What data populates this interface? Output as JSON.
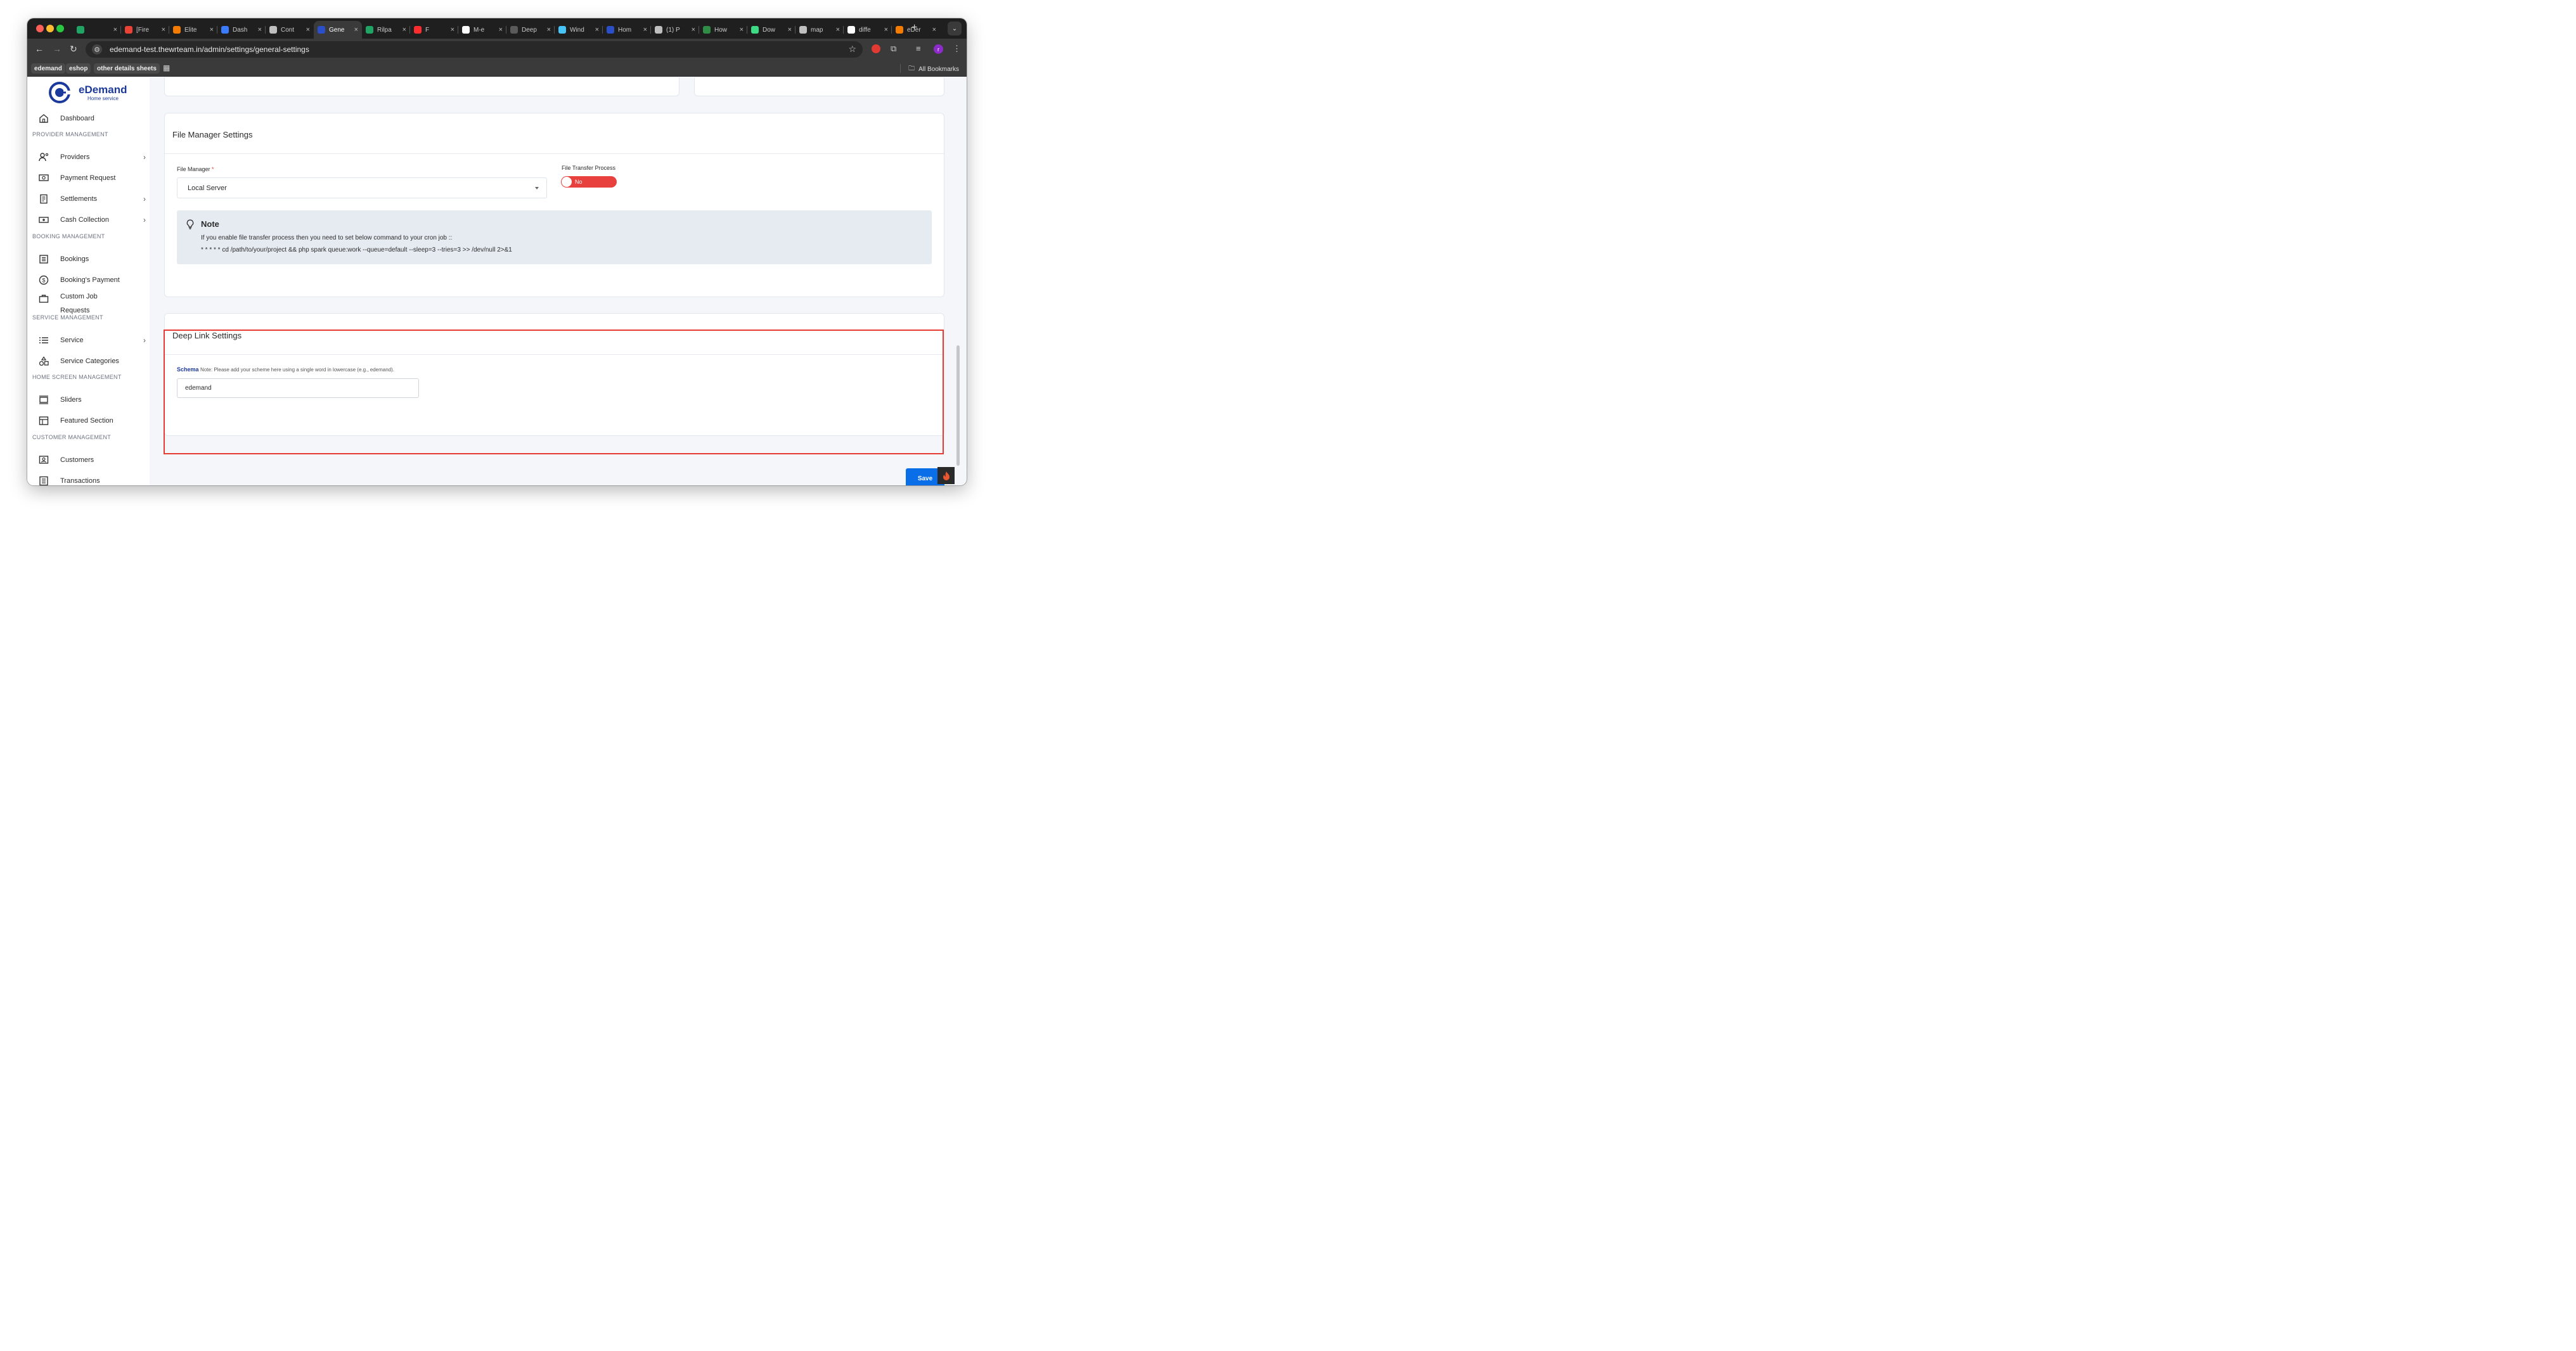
{
  "browser": {
    "tabs": [
      {
        "title": "",
        "favicon": "sheets-icon",
        "color": "#1fa463"
      },
      {
        "title": "[Fire",
        "favicon": "gmail-icon",
        "color": "#ea4335"
      },
      {
        "title": "Elite",
        "favicon": "fire-icon",
        "color": "#f57c00"
      },
      {
        "title": "Dash",
        "favicon": "play-icon",
        "color": "#3b7bff"
      },
      {
        "title": "Cont",
        "favicon": "openai-icon",
        "color": "#bfbfbf"
      },
      {
        "title": "Gene",
        "favicon": "edemand-icon",
        "color": "#2a4fc9"
      },
      {
        "title": "Rilpa",
        "favicon": "sheets-icon",
        "color": "#1fa463"
      },
      {
        "title": "F",
        "favicon": "youtube-music-icon",
        "color": "#ff2d2d"
      },
      {
        "title": "M-e",
        "favicon": "github-icon",
        "color": "#ffffff"
      },
      {
        "title": "Deep",
        "favicon": "link-icon",
        "color": "#5a5a5a"
      },
      {
        "title": "Wind",
        "favicon": "flutter-icon",
        "color": "#47c5fb"
      },
      {
        "title": "Hom",
        "favicon": "edemand-icon",
        "color": "#2a4fc9"
      },
      {
        "title": "(1) P",
        "favicon": "globe-icon",
        "color": "#bfbfbf"
      },
      {
        "title": "How",
        "favicon": "gfg-icon",
        "color": "#2f8d46"
      },
      {
        "title": "Dow",
        "favicon": "android-icon",
        "color": "#3ddc84"
      },
      {
        "title": "map",
        "favicon": "globe-icon",
        "color": "#bfbfbf"
      },
      {
        "title": "diffe",
        "favicon": "google-icon",
        "color": "#ffffff"
      },
      {
        "title": "eDer",
        "favicon": "fire-icon",
        "color": "#f57c00"
      }
    ],
    "url": "edemand-test.thewrteam.in/admin/settings/general-settings",
    "bookmarks": [
      "edemand",
      "eshop",
      "other details sheets"
    ],
    "all_bookmarks": "All Bookmarks",
    "profile_initial": "r"
  },
  "sidebar": {
    "brand": "eDemand",
    "brand_sub": "Home service",
    "dashboard": "Dashboard",
    "sections": {
      "provider": "PROVIDER MANAGEMENT",
      "booking": "BOOKING MANAGEMENT",
      "service": "SERVICE MANAGEMENT",
      "home": "HOME SCREEN MANAGEMENT",
      "customer": "CUSTOMER MANAGEMENT"
    },
    "items": {
      "providers": "Providers",
      "payment_request": "Payment Request",
      "settlements": "Settlements",
      "cash_collection": "Cash Collection",
      "bookings": "Bookings",
      "bookings_payment": "Booking's Payment",
      "custom_job_1": "Custom Job",
      "custom_job_2": "Requests",
      "service": "Service",
      "service_categories": "Service Categories",
      "sliders": "Sliders",
      "featured_section": "Featured Section",
      "customers": "Customers",
      "transactions": "Transactions"
    }
  },
  "file_manager": {
    "title": "File Manager Settings",
    "file_manager_label": "File Manager",
    "required_mark": "*",
    "file_manager_value": "Local Server",
    "transfer_label": "File Transfer Process",
    "transfer_toggle": "No",
    "note_title": "Note",
    "note_line1": "If you enable file transfer process then you need to set below command to your cron job ::",
    "note_line2": "* * * * * cd /path/to/your/project && php spark queue:work --queue=default --sleep=3 --tries=3 >> /dev/null 2>&1"
  },
  "deep_link": {
    "title": "Deep Link Settings",
    "schema_label": "Schema",
    "schema_note": "Note: Please add your scheme here using a single word in lowercase (e.g., edemand).",
    "schema_value": "edemand"
  },
  "actions": {
    "save": "Save"
  },
  "colors": {
    "brand": "#1c3a9c",
    "primary_button": "#0a6ee8",
    "toggle_off": "#e8403c",
    "highlight": "#e63b33"
  }
}
